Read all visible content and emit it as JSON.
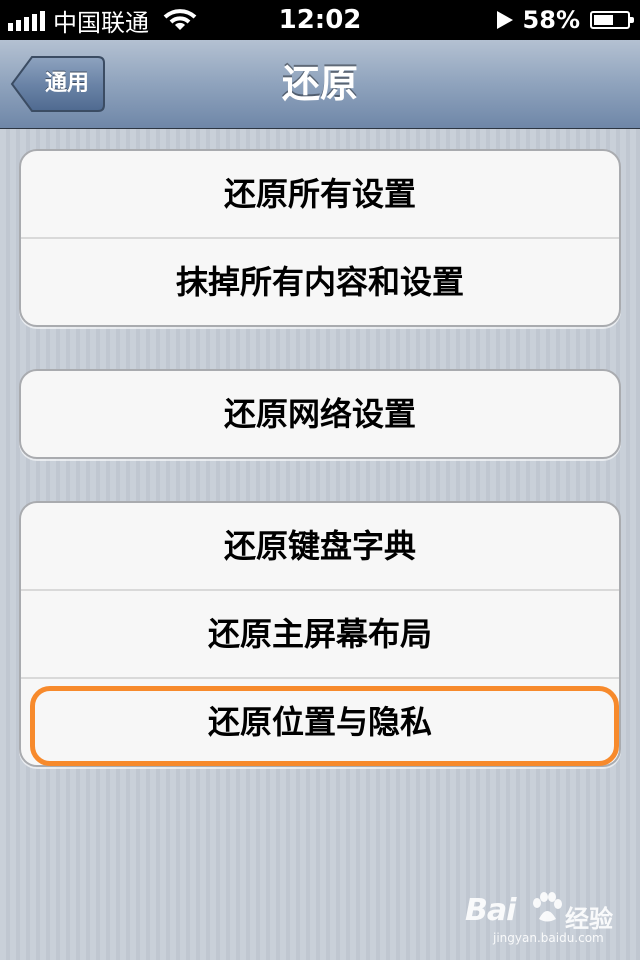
{
  "status_bar": {
    "carrier": "中国联通",
    "time": "12:02",
    "battery_percent": "58%",
    "battery_level": 0.58,
    "icons": [
      "signal-bars-icon",
      "wifi-icon",
      "location-arrow-icon",
      "battery-icon"
    ]
  },
  "nav": {
    "back_label": "通用",
    "title": "还原"
  },
  "groups": [
    {
      "items": [
        "还原所有设置",
        "抹掉所有内容和设置"
      ]
    },
    {
      "items": [
        "还原网络设置"
      ]
    },
    {
      "items": [
        "还原键盘字典",
        "还原主屏幕布局",
        "还原位置与隐私"
      ]
    }
  ],
  "highlight": {
    "item": "还原位置与隐私",
    "color": "#f78a2c"
  },
  "watermark": {
    "logo": "Bai",
    "text": "经验",
    "url": "jingyan.baidu.com"
  },
  "colors": {
    "nav_gradient_top": "#b4c1d2",
    "nav_gradient_bottom": "#6f87a8",
    "background": "#c5ccd5",
    "cell": "#f7f7f7"
  }
}
